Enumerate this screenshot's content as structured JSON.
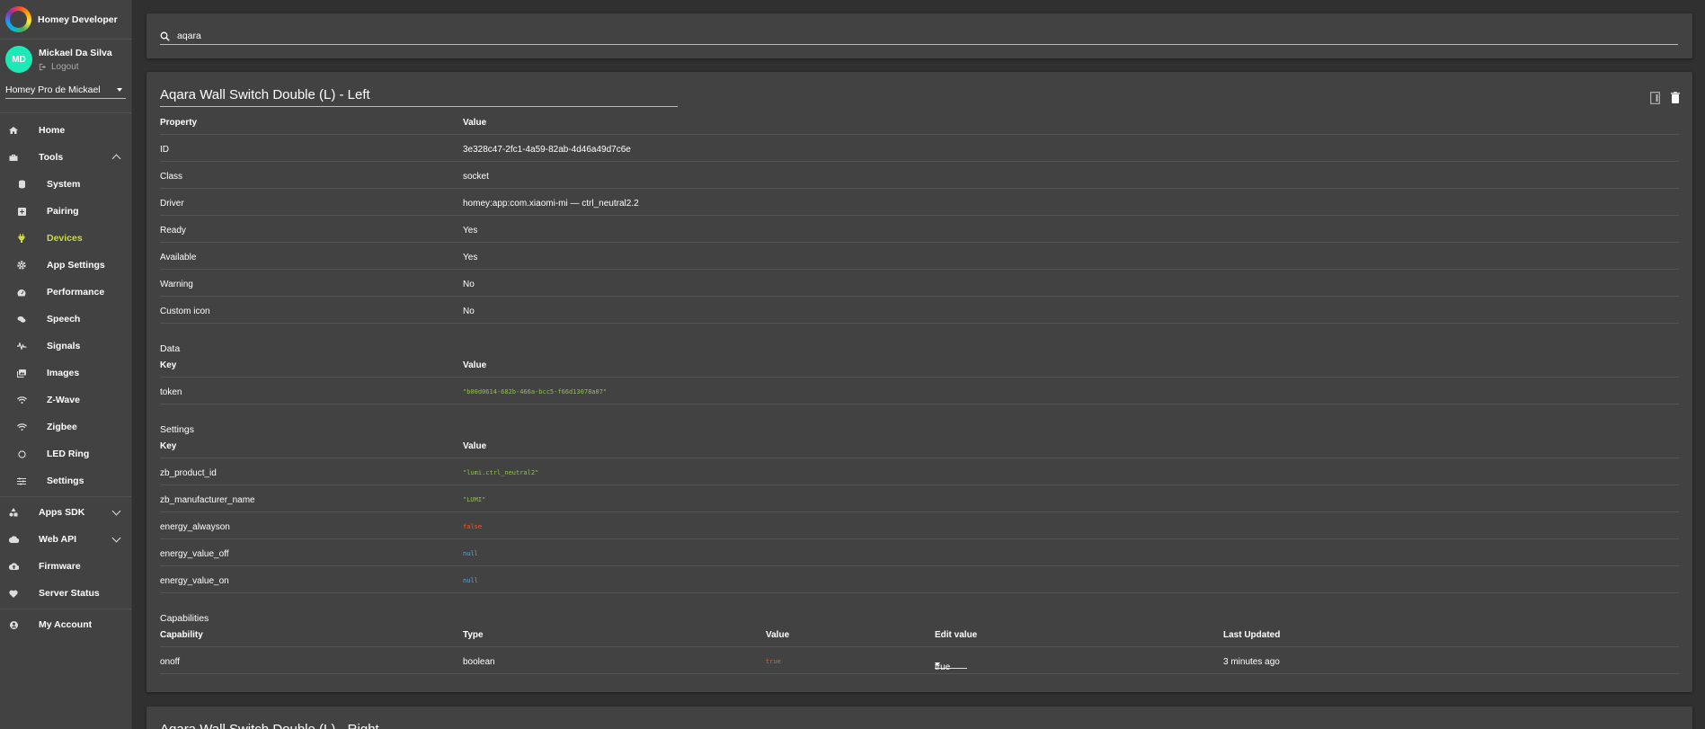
{
  "brand": {
    "title": "Homey Developer"
  },
  "user": {
    "initials": "MD",
    "name": "Mickael Da Silva",
    "logout": "Logout"
  },
  "homey_select": {
    "value": "Homey Pro de Mickael"
  },
  "nav": {
    "home": "Home",
    "tools": "Tools",
    "system": "System",
    "pairing": "Pairing",
    "devices": "Devices",
    "app_settings": "App Settings",
    "performance": "Performance",
    "speech": "Speech",
    "signals": "Signals",
    "images": "Images",
    "zwave": "Z-Wave",
    "zigbee": "Zigbee",
    "led_ring": "LED Ring",
    "settings": "Settings",
    "apps_sdk": "Apps SDK",
    "web_api": "Web API",
    "firmware": "Firmware",
    "server_status": "Server Status",
    "my_account": "My Account"
  },
  "search": {
    "value": "aqara"
  },
  "device": {
    "title": "Aqara Wall Switch Double (L) - Left",
    "props_header": {
      "property": "Property",
      "value": "Value"
    },
    "props": [
      {
        "key": "ID",
        "value": "3e328c47-2fc1-4a59-82ab-4d46a49d7c6e"
      },
      {
        "key": "Class",
        "value": "socket"
      },
      {
        "key": "Driver",
        "value": "homey:app:com.xiaomi-mi — ctrl_neutral2.2"
      },
      {
        "key": "Ready",
        "value": "Yes"
      },
      {
        "key": "Available",
        "value": "Yes"
      },
      {
        "key": "Warning",
        "value": "No"
      },
      {
        "key": "Custom icon",
        "value": "No"
      }
    ],
    "data_label": "Data",
    "data_header": {
      "key": "Key",
      "value": "Value"
    },
    "data_rows": [
      {
        "key": "token",
        "value": "\"b00d0614-682b-466a-bcc5-f66d13078a07\""
      }
    ],
    "settings_label": "Settings",
    "settings_header": {
      "key": "Key",
      "value": "Value"
    },
    "settings_rows": [
      {
        "key": "zb_product_id",
        "value": "\"lumi.ctrl_neutral2\""
      },
      {
        "key": "zb_manufacturer_name",
        "value": "\"LUMI\""
      },
      {
        "key": "energy_alwayson",
        "value": "false"
      },
      {
        "key": "energy_value_off",
        "value": "null"
      },
      {
        "key": "energy_value_on",
        "value": "null"
      }
    ],
    "capabilities_label": "Capabilities",
    "cap_header": {
      "capability": "Capability",
      "type": "Type",
      "value": "Value",
      "edit": "Edit value",
      "updated": "Last Updated"
    },
    "cap_rows": [
      {
        "capability": "onoff",
        "type": "boolean",
        "value": "true",
        "edit": "true",
        "updated": "3 minutes ago"
      }
    ]
  },
  "next_device": {
    "title": "Aqara Wall Switch Double (L) - Right"
  },
  "colors": {
    "accent": "#cddc39",
    "avatar": "#1de9b6",
    "string": "#8bc34a",
    "bool": "#ff5722",
    "null": "#5fa8d3"
  }
}
